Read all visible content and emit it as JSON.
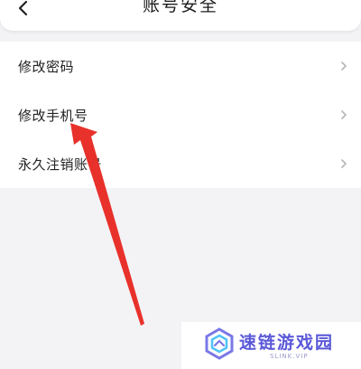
{
  "header": {
    "title": "账号安全",
    "back_icon": "chevron-left-icon"
  },
  "menu": {
    "items": [
      {
        "label": "修改密码",
        "icon": "chevron-right-icon"
      },
      {
        "label": "修改手机号",
        "icon": "chevron-right-icon"
      },
      {
        "label": "永久注销账号",
        "icon": "chevron-right-icon"
      }
    ]
  },
  "annotation": {
    "arrow_color": "#e8312b"
  },
  "watermark": {
    "title": "速链游戏园",
    "subtitle": "SLINK.VIP",
    "color": "#5a58d8"
  }
}
